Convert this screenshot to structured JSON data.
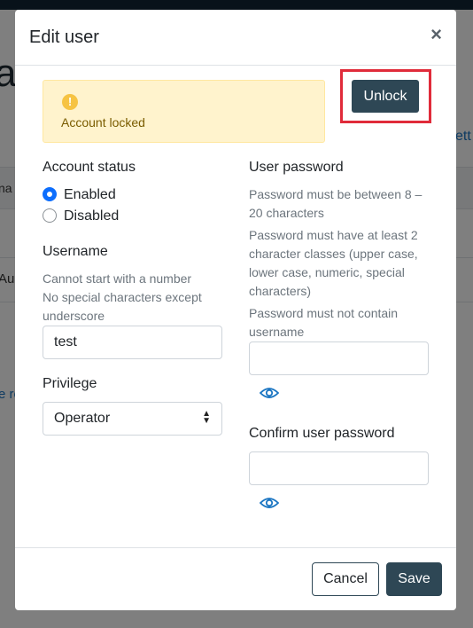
{
  "background": {
    "title_fragment": "a",
    "link_right_fragment": "ett",
    "table_head_fragment": "na",
    "row_fragment": "Au",
    "link_left_fragment": "e ro"
  },
  "modal": {
    "title": "Edit user",
    "close_glyph": "×",
    "alert": {
      "icon_glyph": "!",
      "text": "Account locked"
    },
    "unlock_label": "Unlock",
    "account_status": {
      "label": "Account status",
      "options": [
        "Enabled",
        "Disabled"
      ],
      "selected": "Enabled"
    },
    "username": {
      "label": "Username",
      "help_1": "Cannot start with a number",
      "help_2": "No special characters except underscore",
      "value": "test"
    },
    "privilege": {
      "label": "Privilege",
      "value": "Operator"
    },
    "user_password": {
      "label": "User password",
      "help_1": "Password must be between 8 – 20 characters",
      "help_2": "Password must have at least 2 character classes (upper case, lower case, numeric, special characters)",
      "help_3": "Password must not contain username",
      "value": ""
    },
    "confirm_password": {
      "label": "Confirm user password",
      "value": ""
    },
    "cancel_label": "Cancel",
    "save_label": "Save"
  },
  "colors": {
    "primary": "#2e4755",
    "highlight": "#e02b3a",
    "alert_bg": "#fff3cd",
    "link": "#1a75c2"
  },
  "icons": {
    "close": "close-icon",
    "warning": "warning-icon",
    "eye": "eye-icon",
    "select_arrows": "sort-icon"
  }
}
